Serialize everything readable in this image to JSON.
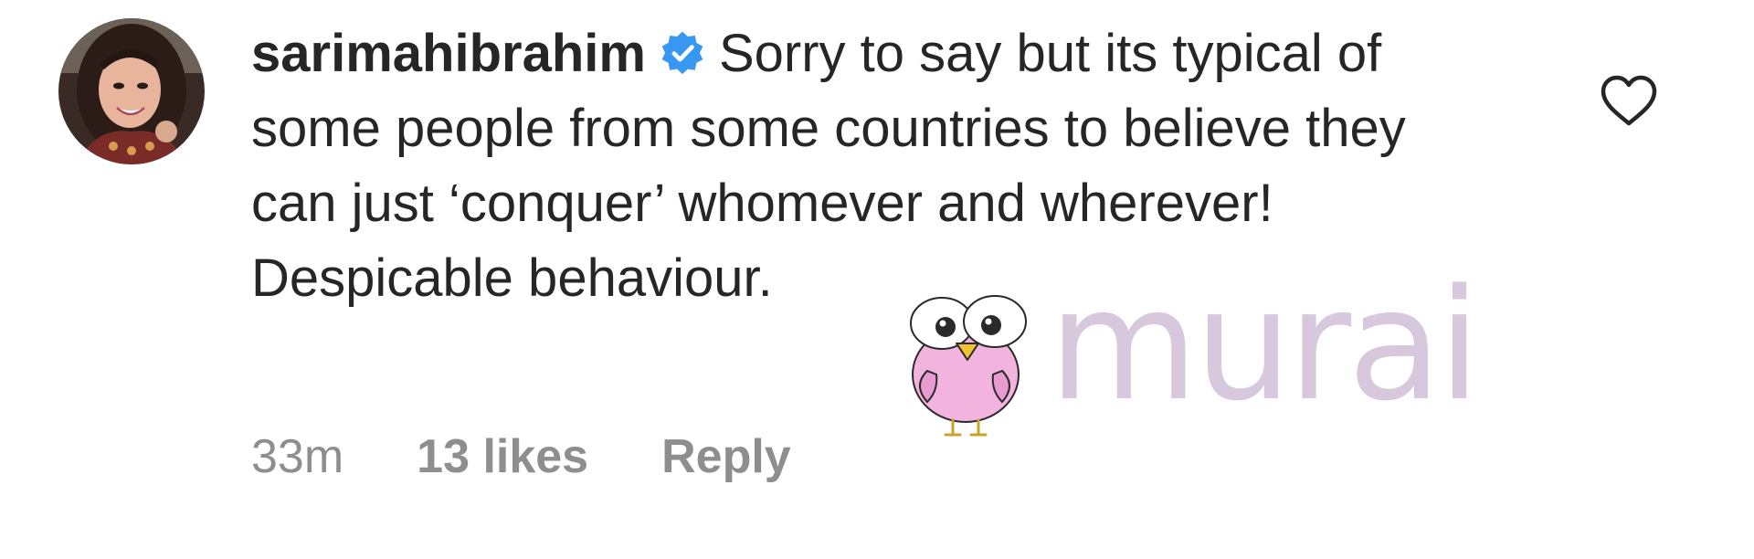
{
  "comment": {
    "username": "sarimahibrahim",
    "verified_icon": "verified-badge-icon",
    "text": "Sorry to say but its typical of some people from some countries to believe they can just ‘conquer’ whomever and wherever! Despicable behaviour.",
    "time": "33m",
    "likes": "13 likes",
    "reply_label": "Reply",
    "like_icon": "heart-outline-icon"
  },
  "watermark": {
    "text": "murai",
    "icon": "cartoon-bird-icon"
  },
  "colors": {
    "text": "#262626",
    "meta": "#8e8e8e",
    "verified": "#3897f0",
    "watermark": "#d7c8dd",
    "bird": "#f2b3de"
  }
}
